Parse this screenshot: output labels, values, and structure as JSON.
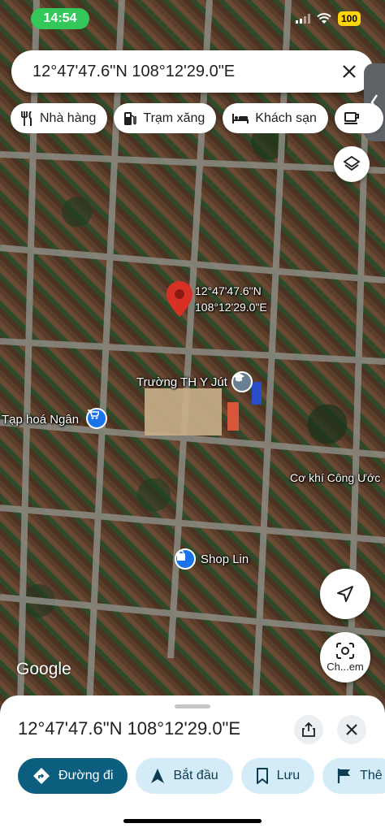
{
  "status_bar": {
    "time": "14:54",
    "battery": "100"
  },
  "search": {
    "query": "12°47'47.6\"N 108°12'29.0\"E"
  },
  "chips": [
    {
      "label": "Nhà hàng",
      "icon": "restaurant-icon"
    },
    {
      "label": "Trạm xăng",
      "icon": "gas-station-icon"
    },
    {
      "label": "Khách sạn",
      "icon": "hotel-icon"
    }
  ],
  "map": {
    "pin_label_line1": "12°47'47.6\"N",
    "pin_label_line2": "108°12'29.0\"E",
    "poi_school": "Trường TH Y Jút",
    "poi_store": "Tạp hoá Ngân",
    "poi_workshop": "Cơ khí Công Ước",
    "poi_shop": "Shop Lin",
    "google_logo": "Google",
    "lens_label": "Ch...em"
  },
  "sheet": {
    "title": "12°47'47.6\"N 108°12'29.0\"E",
    "actions": [
      {
        "label": "Đường đi",
        "icon": "directions-icon"
      },
      {
        "label": "Bắt đầu",
        "icon": "navigation-arrow-icon"
      },
      {
        "label": "Lưu",
        "icon": "bookmark-icon"
      },
      {
        "label": "Thê",
        "icon": "flag-icon"
      }
    ]
  },
  "colors": {
    "accent": "#0b5e7e",
    "pin": "#d93025",
    "time_pill": "#34c759"
  }
}
